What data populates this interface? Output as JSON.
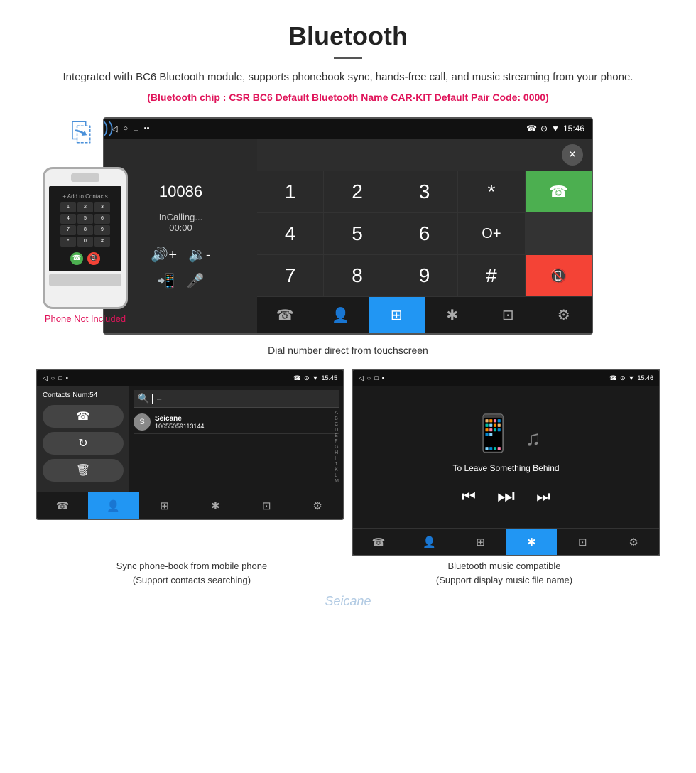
{
  "header": {
    "title": "Bluetooth",
    "description": "Integrated with BC6 Bluetooth module, supports phonebook sync, hands-free call, and music streaming from your phone.",
    "specs": "(Bluetooth chip : CSR BC6    Default Bluetooth Name CAR-KIT    Default Pair Code: 0000)"
  },
  "phone_label": "Phone Not Included",
  "dial_screen": {
    "status_left": [
      "◁",
      "○",
      "□",
      "■▪"
    ],
    "status_right": [
      "☎",
      "⊙",
      "▼",
      "15:46"
    ],
    "number": "10086",
    "calling_text": "InCalling...",
    "timer": "00:00",
    "keys": [
      {
        "label": "1"
      },
      {
        "label": "2"
      },
      {
        "label": "3"
      },
      {
        "label": "*"
      },
      {
        "label": "call",
        "type": "green",
        "icon": "☎"
      },
      {
        "label": "4"
      },
      {
        "label": "5"
      },
      {
        "label": "6"
      },
      {
        "label": "0+"
      },
      {
        "label": ""
      },
      {
        "label": "7"
      },
      {
        "label": "8"
      },
      {
        "label": "9"
      },
      {
        "label": "#"
      },
      {
        "label": "end",
        "type": "red",
        "icon": "☎"
      }
    ],
    "bottom_icons": [
      "☎↗",
      "👤",
      "⊞",
      "✱",
      "⊡",
      "⚙"
    ],
    "caption": "Dial number direct from touchscreen"
  },
  "contacts_screen": {
    "status_time": "15:45",
    "contacts_num": "Contacts Num:54",
    "contact_name": "Seicane",
    "contact_number": "10655059113144",
    "caption": "Sync phone-book from mobile phone\n(Support contacts searching)"
  },
  "music_screen": {
    "status_time": "15:46",
    "song_title": "To Leave Something Behind",
    "caption": "Bluetooth music compatible\n(Support display music file name)"
  },
  "watermark": "Seicane"
}
